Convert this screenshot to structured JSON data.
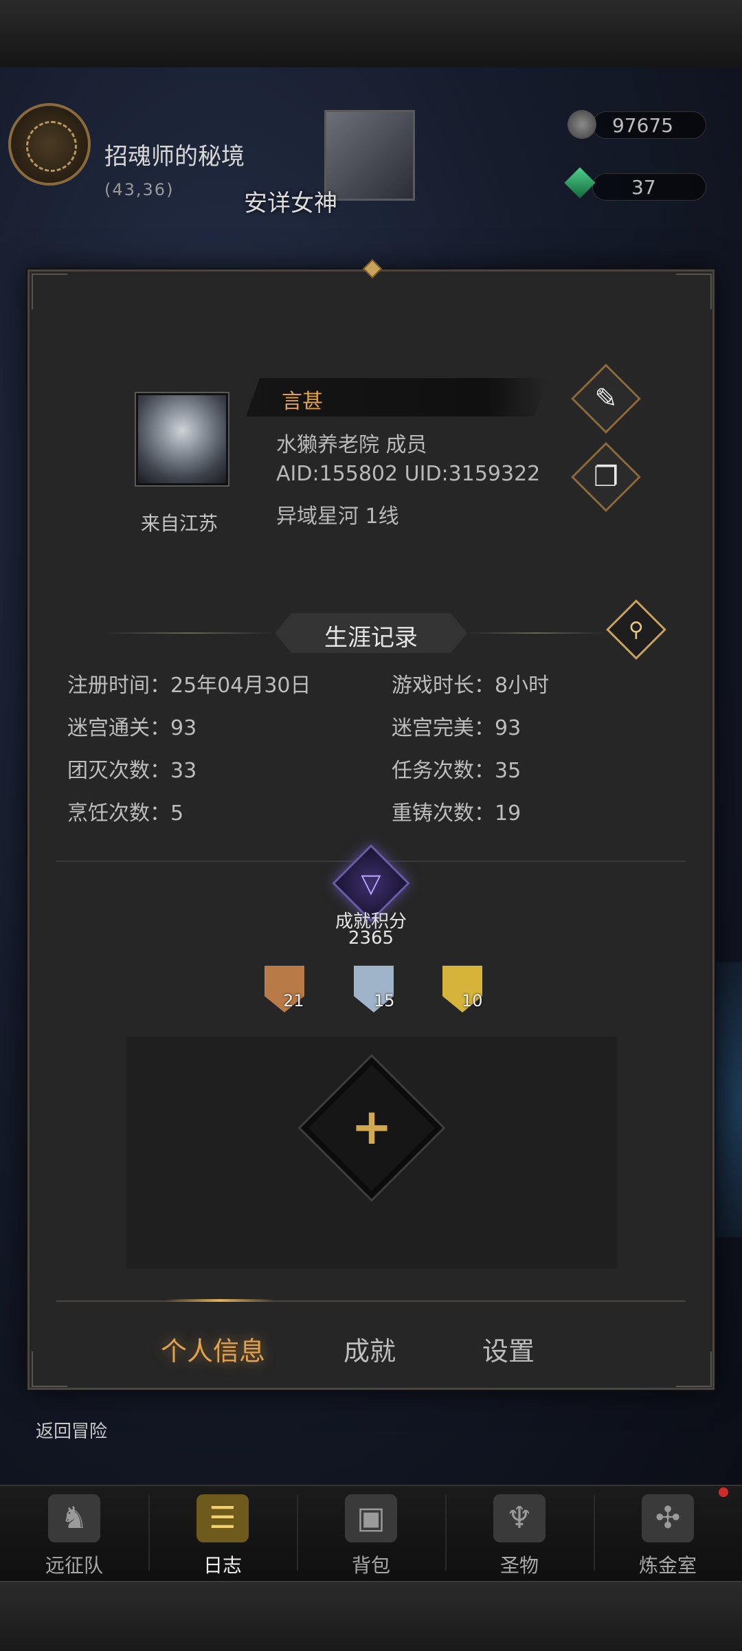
{
  "location": {
    "name": "招魂师的秘境",
    "coords": "(43,36)"
  },
  "npc": {
    "label": "安详女神"
  },
  "currency": {
    "stone": "97675",
    "gem": "37"
  },
  "profile": {
    "name": "言甚",
    "guild_line": "水獭养老院  成员",
    "ids": "AID:155802 UID:3159322",
    "server": "异域星河  1线",
    "origin": "来自江苏"
  },
  "career": {
    "title": "生涯记录",
    "stats": [
      {
        "label": "注册时间：25年04月30日"
      },
      {
        "label": "游戏时长：8小时"
      },
      {
        "label": "迷宫通关：93"
      },
      {
        "label": "迷宫完美：93"
      },
      {
        "label": "团灭次数：33"
      },
      {
        "label": "任务次数：35"
      },
      {
        "label": "烹饪次数：5"
      },
      {
        "label": "重铸次数：19"
      }
    ]
  },
  "achievement": {
    "label": "成就积分",
    "value": "2365",
    "medals": [
      {
        "count": "21",
        "color": "#b87a46"
      },
      {
        "count": "15",
        "color": "#9fb4c8"
      },
      {
        "count": "10",
        "color": "#d6b43a"
      }
    ]
  },
  "tabs": {
    "items": [
      "个人信息",
      "成就",
      "设置"
    ],
    "active": 0
  },
  "return_label": "返回冒险",
  "nav": {
    "items": [
      {
        "label": "远征队",
        "icon": "helmet-icon"
      },
      {
        "label": "日志",
        "icon": "scroll-icon"
      },
      {
        "label": "背包",
        "icon": "backpack-icon"
      },
      {
        "label": "圣物",
        "icon": "chalice-icon"
      },
      {
        "label": "炼金室",
        "icon": "alchemy-icon"
      }
    ],
    "active": 1
  },
  "colors": {
    "accent": "#e2a24c",
    "panel": "#262626",
    "border_gold": "#c9a25c"
  }
}
